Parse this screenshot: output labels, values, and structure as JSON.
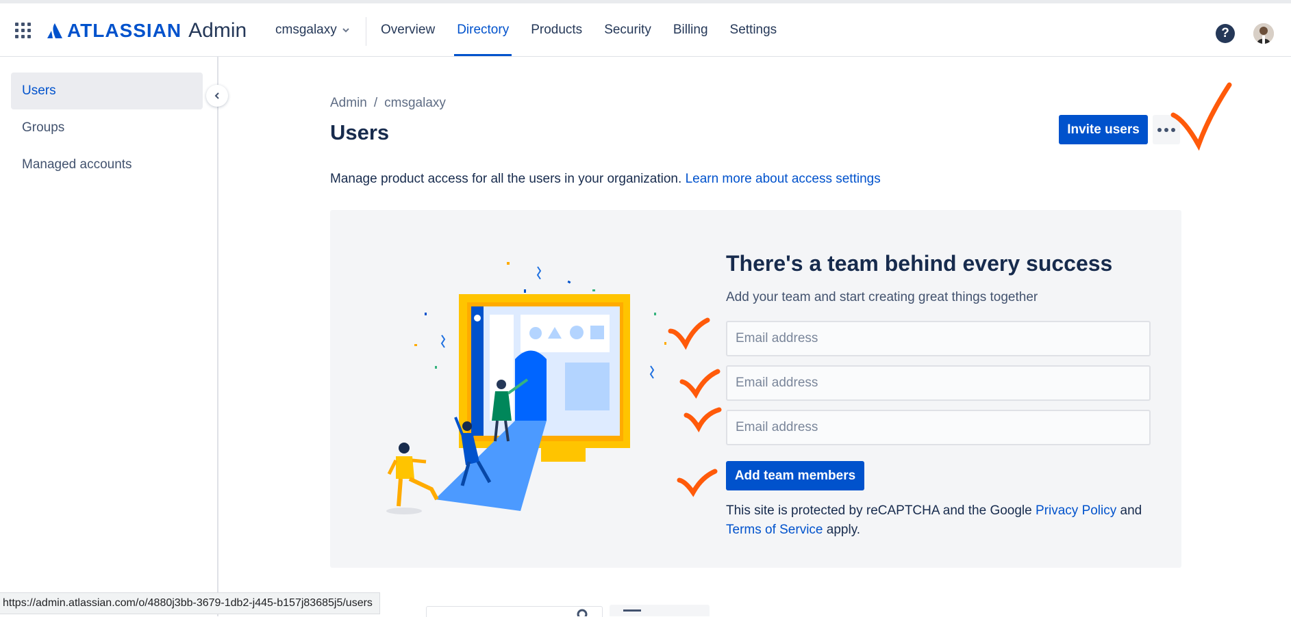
{
  "header": {
    "brand": "ATLASSIAN",
    "product": "Admin",
    "org": "cmsgalaxy",
    "nav": [
      "Overview",
      "Directory",
      "Products",
      "Security",
      "Billing",
      "Settings"
    ],
    "active_nav": "Directory",
    "help_label": "?"
  },
  "sidebar": {
    "items": [
      {
        "label": "Users"
      },
      {
        "label": "Groups"
      },
      {
        "label": "Managed accounts"
      }
    ],
    "active": "Users"
  },
  "breadcrumb": {
    "items": [
      "Admin",
      "cmsgalaxy"
    ],
    "separator": "/"
  },
  "page": {
    "title": "Users",
    "invite_label": "Invite users",
    "description": "Manage product access for all the users in your organization.",
    "learn_more": "Learn more about access settings"
  },
  "card": {
    "title": "There's a team behind every success",
    "subtitle": "Add your team and start creating great things together",
    "email_placeholder": "Email address",
    "add_button": "Add team members",
    "captcha_text": "This site is protected by reCAPTCHA and the Google",
    "privacy_link": "Privacy Policy",
    "and": "and",
    "terms_link": "Terms of Service",
    "apply": "apply."
  },
  "status_bar": {
    "url": "https://admin.atlassian.com/o/4880j3bb-3679-1db2-j445-b157j83685j5/users"
  },
  "colors": {
    "primary": "#0052cc",
    "text": "#172b4d",
    "subtle": "#42526e",
    "card_bg": "#f4f5f7",
    "annotation": "#ff5a0a"
  },
  "icons": [
    "app-switcher-icon",
    "atlassian-logo-icon",
    "chevron-down-icon",
    "help-icon",
    "chevron-left-icon",
    "more-icon"
  ]
}
